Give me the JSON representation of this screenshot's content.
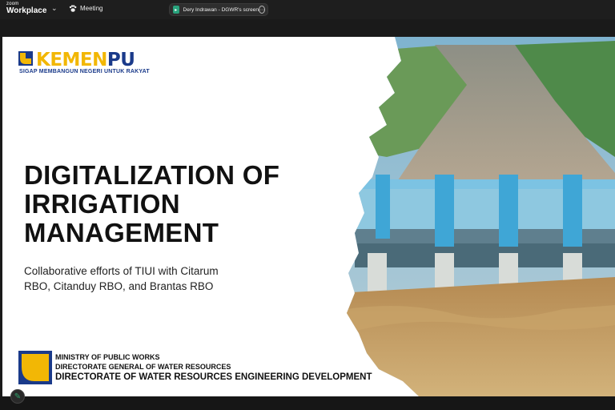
{
  "topbar": {
    "brand_small": "zoom",
    "brand_big": "Workplace",
    "meeting_label": "Meeting",
    "share_label": "Dery Indrawan - DGWR's screen"
  },
  "slide": {
    "logo_word_main": "KEMEN",
    "logo_word_accent": "PU",
    "logo_tagline": "SIGAP MEMBANGUN NEGERI UNTUK RAKYAT",
    "title_line1": "DIGITALIZATION OF",
    "title_line2": "IRRIGATION",
    "title_line3": "MANAGEMENT",
    "subtitle_line1": "Collaborative efforts of TIUI with Citarum",
    "subtitle_line2": "RBO, Citanduy RBO,  and Brantas  RBO",
    "footer_line1": "MINISTRY OF PUBLIC WORKS",
    "footer_line2": "DIRECTORATE GENERAL OF WATER RESOURCES",
    "footer_line3": "DIRECTORATE OF WATER RESOURCES ENGINEERING DEVELOPMENT"
  },
  "colors": {
    "brand_yellow": "#f2b705",
    "brand_blue": "#1a3a8a",
    "zoom_green": "#29a37d"
  },
  "icons": [
    "chevron-down-icon",
    "paw-icon",
    "screen-share-icon",
    "more-icon",
    "annotate-icon"
  ]
}
